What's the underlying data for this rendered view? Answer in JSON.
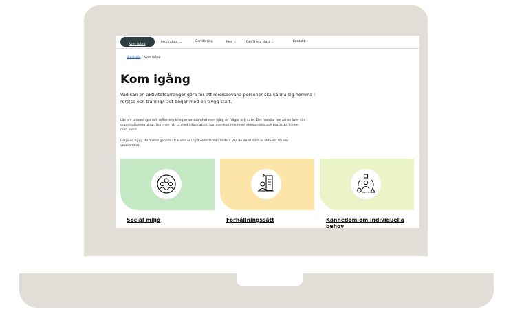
{
  "nav": {
    "items": [
      {
        "label": "Kom igång"
      },
      {
        "label": "Inspiration"
      },
      {
        "label": "Certifiering"
      },
      {
        "label": "Mer"
      },
      {
        "label": "Om Trygg start"
      },
      {
        "label": "Kontakt"
      }
    ],
    "chevron": "⌄"
  },
  "breadcrumb": {
    "home": "Startsida",
    "separator": " / ",
    "current": "Kom igång"
  },
  "page": {
    "title": "Kom igång",
    "lead": "Vad kan en aktivitetsarrangör göra för att rörelseovana personer ska känna sig hemma i rörelse och träning? Det börjar med en trygg start.",
    "paragraph1": "Läs om utmaningar och reflektera kring er verksamhet med hjälp av frågor och case. Det handlar om att se över sin organisationsstruktur, hur man når ut med information, hur man kan minimera ekonomiska och praktiska hinder med mera.",
    "paragraph2": "Börja er Trygg start-resa genom att klicka er in på olika teman nedan. Välj de delar som är aktuella för din verksamhet."
  },
  "cards": [
    {
      "title": "Social miljö",
      "color": "#c4e8c4",
      "icon": "group-icon"
    },
    {
      "title": "Förhållningssätt",
      "color": "#fde4a8",
      "icon": "presentation-icon"
    },
    {
      "title": "Kännedom om individuella behov",
      "color": "#eaf3c6",
      "icon": "person-shapes-icon"
    }
  ],
  "colors": {
    "nav_active_bg": "#2e3d40",
    "laptop": "#e3ddd8",
    "link": "#1f5fbf"
  }
}
